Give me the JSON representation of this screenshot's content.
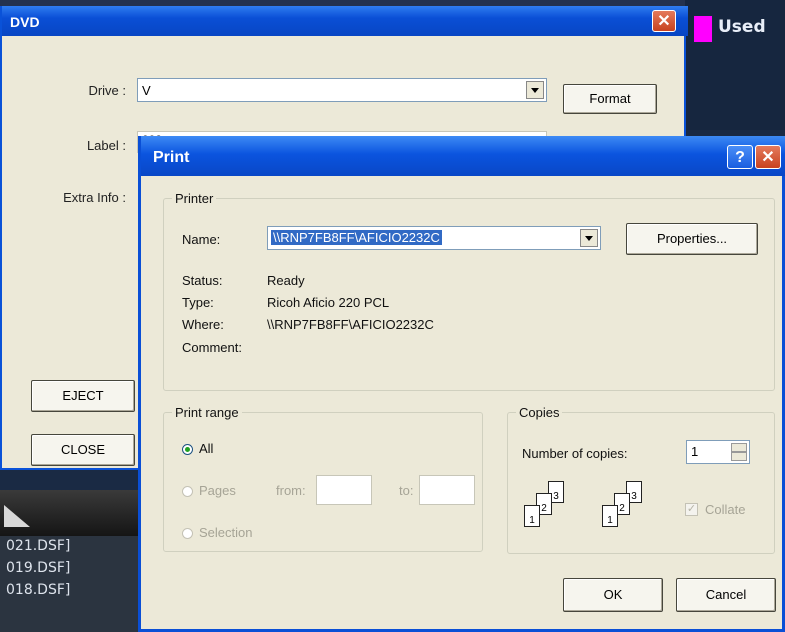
{
  "background": {
    "used_label": "Used",
    "files": [
      "021.DSF]",
      "019.DSF]",
      "018.DSF]"
    ]
  },
  "dvd_window": {
    "title": "DVD",
    "close_glyph": "✕",
    "drive_label": "Drive :",
    "drive_value": "V",
    "format_button": "Format",
    "label_label": "Label :",
    "label_value": "003",
    "extra_info_label": "Extra Info :",
    "eject_button": "EJECT",
    "close_button": "CLOSE"
  },
  "print_dialog": {
    "title": "Print",
    "help_glyph": "?",
    "close_glyph": "✕",
    "printer_group": "Printer",
    "name_label": "Name:",
    "name_value": "\\\\RNP7FB8FF\\AFICIO2232C",
    "properties_button": "Properties...",
    "status_label": "Status:",
    "status_value": "Ready",
    "type_label": "Type:",
    "type_value": "Ricoh Aficio 220 PCL",
    "where_label": "Where:",
    "where_value": "\\\\RNP7FB8FF\\AFICIO2232C",
    "comment_label": "Comment:",
    "range_group": "Print range",
    "all_label": "All",
    "pages_label": "Pages",
    "from_label": "from:",
    "to_label": "to:",
    "selection_label": "Selection",
    "copies_group": "Copies",
    "copies_label": "Number of copies:",
    "copies_value": "1",
    "collate_label": "Collate",
    "collate_check": "✓",
    "ok_button": "OK",
    "cancel_button": "Cancel"
  },
  "colors": {
    "title_bar": "#0a4fd6",
    "dialog_face": "#ece9d8",
    "used_swatch": "#ff00ff"
  }
}
